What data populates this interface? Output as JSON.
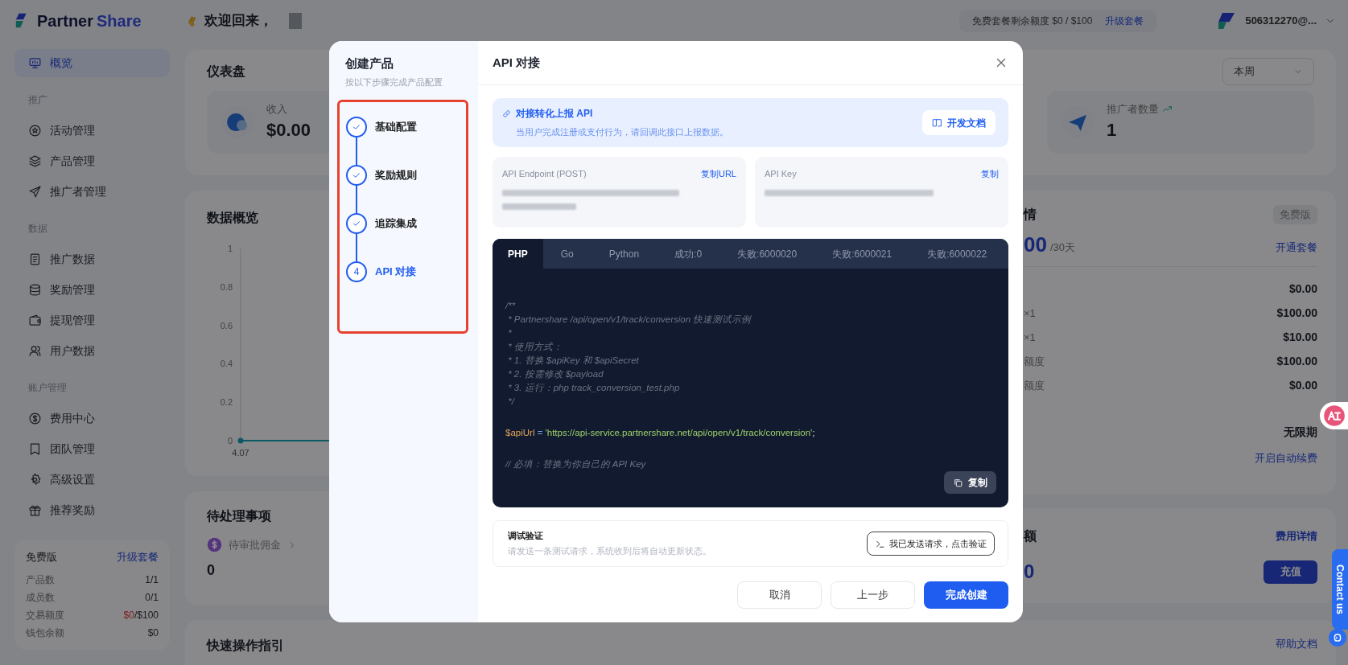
{
  "header": {
    "welcome": "欢迎回来，",
    "quota": "免费套餐剩余额度 $0 / $100",
    "upgrade": "升级套餐",
    "account": "506312270@..."
  },
  "sidebar": {
    "logo": [
      "Partner",
      "Share"
    ],
    "items": [
      {
        "kind": "item",
        "label": "概览",
        "selected": true
      },
      {
        "kind": "section",
        "label": "推广"
      },
      {
        "kind": "item",
        "label": "活动管理",
        "selected": false
      },
      {
        "kind": "item",
        "label": "产品管理",
        "selected": false
      },
      {
        "kind": "item",
        "label": "推广者管理",
        "selected": false
      },
      {
        "kind": "section",
        "label": "数据"
      },
      {
        "kind": "item",
        "label": "推广数据",
        "selected": false
      },
      {
        "kind": "item",
        "label": "奖励管理",
        "selected": false
      },
      {
        "kind": "item",
        "label": "提现管理",
        "selected": false
      },
      {
        "kind": "item",
        "label": "用户数据",
        "selected": false
      },
      {
        "kind": "section",
        "label": "账户管理"
      },
      {
        "kind": "item",
        "label": "费用中心",
        "selected": false
      },
      {
        "kind": "item",
        "label": "团队管理",
        "selected": false
      },
      {
        "kind": "item",
        "label": "高级设置",
        "selected": false
      },
      {
        "kind": "item",
        "label": "推荐奖励",
        "selected": false
      }
    ],
    "plan": {
      "title": "免费版",
      "link": "升级套餐",
      "rows": [
        {
          "label": "产品数",
          "value": "1/1"
        },
        {
          "label": "成员数",
          "value": "0/1"
        },
        {
          "label": "交易额度",
          "used": "$0",
          "value": "/$100"
        },
        {
          "label": "钱包余额",
          "value": "$0"
        }
      ]
    }
  },
  "dashboard": {
    "title": "仪表盘",
    "period": "本周",
    "stats": [
      {
        "label": "收入",
        "value": "$0.00"
      },
      {
        "label": "推广者数量",
        "value": "1"
      }
    ]
  },
  "overview": {
    "title": "数据概览",
    "chart_data": {
      "type": "line",
      "x": [
        "4.07"
      ],
      "yticks": [
        0,
        0.2,
        0.4,
        0.6,
        0.8,
        1
      ],
      "ylim": [
        0,
        1
      ],
      "series": [
        {
          "color": "#14a3b8",
          "marker": "circle",
          "values": [
            0
          ]
        }
      ]
    }
  },
  "pending": {
    "title": "待处理事项",
    "items": [
      {
        "label": "待审批佣金",
        "count": "0"
      }
    ]
  },
  "plan_card": {
    "title": "情",
    "badge": "免费版",
    "price": "00",
    "period": "/30天",
    "action": "开通套餐",
    "rows": [
      {
        "value": "$0.00"
      },
      {
        "label": "×1",
        "value": "$100.00"
      },
      {
        "label": "×1",
        "value": "$10.00"
      },
      {
        "label": "额度",
        "value": "$100.00"
      },
      {
        "label": "额度",
        "value": "$0.00"
      }
    ],
    "expiry": "无限期",
    "renew": "开启自动续费"
  },
  "billing_card": {
    "title": "额",
    "link": "费用详情",
    "amount": "0",
    "button": "充值"
  },
  "guide": {
    "title": "快速操作指引",
    "link": "帮助文档"
  },
  "contact": "Contact us",
  "modal": {
    "title": "创建产品",
    "subtitle": "按以下步骤完成产品配置",
    "steps": [
      {
        "label": "基础配置",
        "checked": true,
        "selected": false
      },
      {
        "label": "奖励规则",
        "checked": true,
        "selected": false
      },
      {
        "label": "追踪集成",
        "checked": true,
        "selected": false
      },
      {
        "label": "API 对接",
        "checked": false,
        "selected": true,
        "number": "4"
      }
    ],
    "heading": "API 对接",
    "notice": {
      "title": "对接转化上报 API",
      "text": "当用户完成注册或支付行为，请回调此接口上报数据。",
      "button": "开发文档"
    },
    "credentials": [
      {
        "label": "API Endpoint (POST)",
        "action": "复制URL"
      },
      {
        "label": "API Key",
        "action": "复制"
      }
    ],
    "code": {
      "tabs": [
        {
          "label": "PHP",
          "selected": true
        },
        {
          "label": "Go",
          "selected": false
        },
        {
          "label": "Python",
          "selected": false
        },
        {
          "label": "成功:0",
          "selected": false
        },
        {
          "label": "失败:6000020",
          "selected": false
        },
        {
          "label": "失败:6000021",
          "selected": false
        },
        {
          "label": "失败:6000022",
          "selected": false
        }
      ],
      "lines": [
        {
          "kind": "comment",
          "text": "/**"
        },
        {
          "kind": "comment",
          "text": " * Partnershare /api/open/v1/track/conversion 快速测试示例"
        },
        {
          "kind": "comment",
          "text": " *"
        },
        {
          "kind": "comment",
          "text": " * 使用方式："
        },
        {
          "kind": "comment",
          "text": " * 1. 替换 $apiKey 和 $apiSecret"
        },
        {
          "kind": "comment",
          "text": " * 2. 按需修改 $payload"
        },
        {
          "kind": "comment",
          "text": " * 3. 运行：php track_conversion_test.php"
        },
        {
          "kind": "comment",
          "text": " */"
        },
        {
          "kind": "blank"
        },
        {
          "kind": "code",
          "tokens": [
            {
              "kind": "var",
              "text": "$apiUrl"
            },
            {
              "kind": "op",
              "text": " = "
            },
            {
              "kind": "str",
              "text": "'https://api-service.partnershare.net/api/open/v1/track/conversion'"
            },
            {
              "kind": "punct",
              "text": ";"
            }
          ]
        },
        {
          "kind": "blank"
        },
        {
          "kind": "comment",
          "text": "// 必填：替换为你自己的 API Key"
        }
      ],
      "copy": "复制"
    },
    "verify": {
      "title": "调试验证",
      "text": "请发送一条测试请求，系统收到后将自动更新状态。",
      "button": "我已发送请求，点击验证"
    },
    "buttons": [
      {
        "label": "取消",
        "kind": "secondary"
      },
      {
        "label": "上一步",
        "kind": "secondary"
      },
      {
        "label": "完成创建",
        "kind": "primary"
      }
    ]
  }
}
